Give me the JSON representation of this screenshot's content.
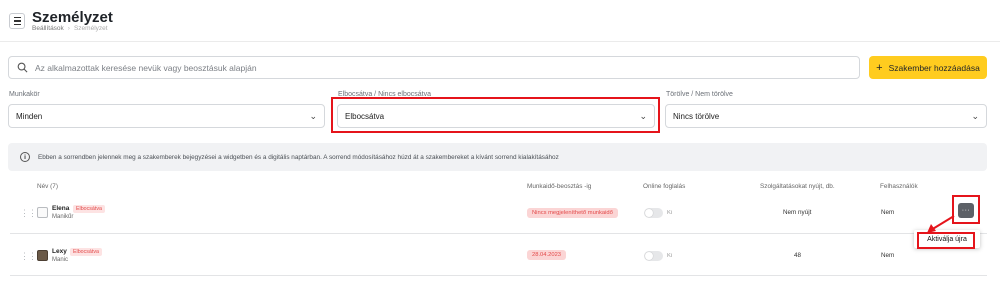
{
  "header": {
    "title": "Személyzet",
    "breadcrumbs": [
      "Beállítások",
      "Személyzet"
    ]
  },
  "search": {
    "placeholder": "Az alkalmazottak keresése nevük vagy beosztásuk alapján"
  },
  "toolbar": {
    "add_label": "Szakember hozzáadása",
    "add_icon": "plus-icon",
    "accent_color": "#ffcc1f"
  },
  "filters": [
    {
      "label": "Munkakör",
      "value": "Minden"
    },
    {
      "label": "Elbocsátva / Nincs elbocsátva",
      "value": "Elbocsátva"
    },
    {
      "label": "Törölve / Nem törölve",
      "value": "Nincs törölve"
    }
  ],
  "info": {
    "icon": "info-icon",
    "text": "Ebben a sorrendben jelennek meg a szakemberek bejegyzései a widgetben és a digitális naptárban. A sorrend módosításához húzd át a szakembereket a kívánt sorrend kialakításához"
  },
  "table": {
    "headers": {
      "name": "Név (7)",
      "schedule": "Munkaidő-beosztás -ig",
      "online": "Online foglalás",
      "services": "Szolgáltatásokat nyújt, db.",
      "user": "Felhasználók"
    },
    "rows": [
      {
        "name": "Elena",
        "badge": "Elbocsátva",
        "role": "Manikűr",
        "schedule": "Nincs megjeleníthető munkaidő",
        "online": "Ki",
        "services": "Nem nyújt",
        "user": "Nem"
      },
      {
        "name": "Lexy",
        "badge": "Elbocsátva",
        "role": "Manic",
        "schedule": "28.04.2023",
        "online": "Ki",
        "services": "48",
        "user": "Nem"
      }
    ]
  },
  "row_menu": {
    "more_label": "···",
    "reactivate_label": "Aktiválja újra"
  },
  "highlight_color": "#e5141b"
}
